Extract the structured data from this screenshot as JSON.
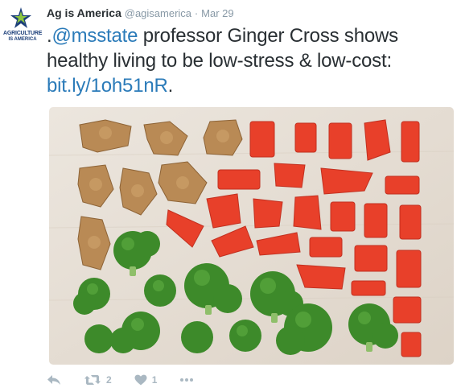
{
  "tweet": {
    "author_name": "Ag is America",
    "author_handle": "@agisamerica",
    "separator": "·",
    "timestamp": "Mar 29",
    "text_prefix": ".",
    "mention": "@msstate",
    "text_body": " professor Ginger Cross shows healthy living to be low-stress & low-cost: ",
    "url": "bit.ly/1oh51nR",
    "text_suffix": "."
  },
  "avatar": {
    "line1": "AGRICULTURE",
    "line2": "IS AMERICA"
  },
  "media": {
    "icon": "photo-vegetables-chicken"
  },
  "actions": {
    "retweet_count": "2",
    "like_count": "1"
  },
  "colors": {
    "link": "#2b7bb9",
    "muted": "#8899a6",
    "icon": "#aab8c2"
  }
}
